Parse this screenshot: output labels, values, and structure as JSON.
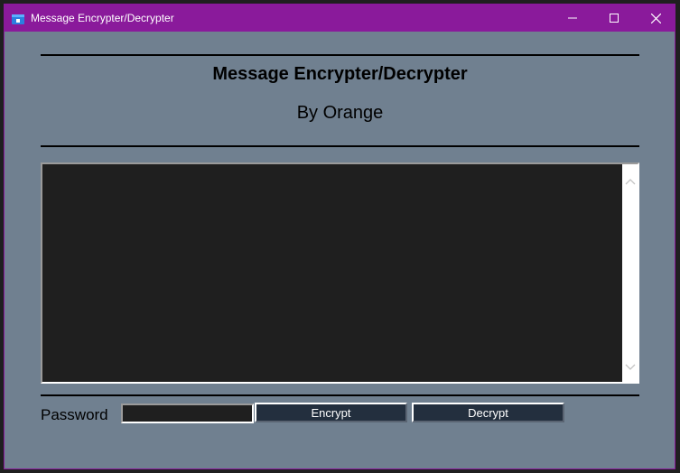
{
  "window": {
    "title": "Message Encrypter/Decrypter",
    "controls": [
      "minimize-icon",
      "maximize-icon",
      "close-icon"
    ]
  },
  "header": {
    "title": "Message Encrypter/Decrypter",
    "subtitle": "By Orange"
  },
  "message_box": {
    "value": ""
  },
  "password": {
    "label": "Password",
    "value": ""
  },
  "buttons": {
    "encrypt_label": "Encrypt",
    "decrypt_label": "Decrypt"
  },
  "colors": {
    "titlebar": "#8a1a9b",
    "background": "#708090",
    "textbox": "#1f1f1f",
    "button": "#232f3e"
  }
}
